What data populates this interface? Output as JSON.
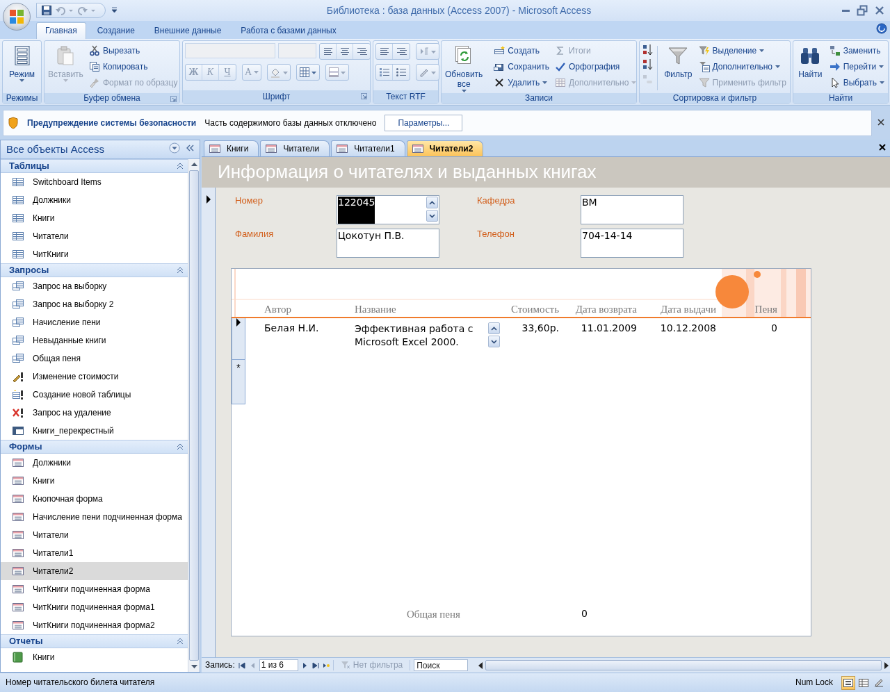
{
  "window": {
    "title": "Библиотека : база данных (Access 2007) - Microsoft Access"
  },
  "ribbon": {
    "tabs": [
      {
        "label": "Главная",
        "selected": true
      },
      {
        "label": "Создание",
        "selected": false
      },
      {
        "label": "Внешние данные",
        "selected": false
      },
      {
        "label": "Работа с базами данных",
        "selected": false
      }
    ],
    "groups": [
      {
        "kind": "views",
        "title": "Режимы",
        "launcher": false,
        "items": [
          {
            "label": "Режим",
            "kind": "large",
            "disabled": false,
            "dropdown": true
          }
        ]
      },
      {
        "kind": "clipboard",
        "title": "Буфер обмена",
        "launcher": true,
        "items": [
          {
            "label": "Вставить",
            "kind": "large",
            "disabled": true,
            "dropdown": true
          },
          {
            "label": "Вырезать",
            "kind": "small",
            "disabled": false,
            "dropdown": false
          },
          {
            "label": "Копировать",
            "kind": "small",
            "disabled": false,
            "dropdown": false
          },
          {
            "label": "Формат по образцу",
            "kind": "small",
            "disabled": true,
            "dropdown": false
          }
        ]
      },
      {
        "kind": "font",
        "title": "Шрифт",
        "launcher": true,
        "items": [
          {
            "label": "Ж",
            "kind": "bold",
            "disabled": true,
            "dropdown": false
          },
          {
            "label": "К",
            "kind": "italic",
            "disabled": true,
            "dropdown": false
          },
          {
            "label": "Ч",
            "kind": "underline",
            "disabled": true,
            "dropdown": false
          },
          {
            "label": "A",
            "kind": "font-color",
            "disabled": true,
            "dropdown": true
          }
        ]
      },
      {
        "kind": "rtf",
        "title": "Текст RTF",
        "launcher": false
      },
      {
        "kind": "records",
        "title": "Записи",
        "launcher": false,
        "items": [
          {
            "label": "Обновить все",
            "kind": "large",
            "disabled": false,
            "dropdown": true
          },
          {
            "label": "Создать",
            "kind": "small",
            "disabled": false,
            "dropdown": false
          },
          {
            "label": "Сохранить",
            "kind": "small",
            "disabled": false,
            "dropdown": false
          },
          {
            "label": "Удалить",
            "kind": "small",
            "disabled": false,
            "dropdown": true
          },
          {
            "label": "Итоги",
            "kind": "small",
            "disabled": true,
            "dropdown": false
          },
          {
            "label": "Орфография",
            "kind": "small",
            "disabled": false,
            "dropdown": false
          },
          {
            "label": "Дополнительно",
            "kind": "small",
            "disabled": true,
            "dropdown": true
          }
        ]
      },
      {
        "kind": "sort",
        "title": "Сортировка и фильтр",
        "launcher": false,
        "items": [
          {
            "label": "Фильтр",
            "kind": "large",
            "disabled": false,
            "dropdown": false
          },
          {
            "label": "Выделение",
            "kind": "small",
            "disabled": false,
            "dropdown": true
          },
          {
            "label": "Дополнительно",
            "kind": "small",
            "disabled": false,
            "dropdown": true
          },
          {
            "label": "Применить фильтр",
            "kind": "small",
            "disabled": true,
            "dropdown": false
          }
        ]
      },
      {
        "kind": "find",
        "title": "Найти",
        "launcher": false,
        "items": [
          {
            "label": "Найти",
            "kind": "large",
            "disabled": false,
            "dropdown": false
          },
          {
            "label": "Заменить",
            "kind": "small",
            "disabled": false,
            "dropdown": false
          },
          {
            "label": "Перейти",
            "kind": "small",
            "disabled": false,
            "dropdown": true
          },
          {
            "label": "Выбрать",
            "kind": "small",
            "disabled": false,
            "dropdown": true
          }
        ]
      }
    ]
  },
  "security_bar": {
    "title": "Предупреждение системы безопасности",
    "message": "Часть содержимого базы данных отключено",
    "button": "Параметры..."
  },
  "navigation": {
    "title": "Все объекты Access",
    "sections": [
      {
        "title": "Таблицы",
        "items": [
          {
            "label": "Switchboard Items",
            "kind": "table",
            "selected": false
          },
          {
            "label": "Должники",
            "kind": "table",
            "selected": false
          },
          {
            "label": "Книги",
            "kind": "table",
            "selected": false
          },
          {
            "label": "Читатели",
            "kind": "table",
            "selected": false
          },
          {
            "label": "ЧитКниги",
            "kind": "table",
            "selected": false
          }
        ]
      },
      {
        "title": "Запросы",
        "items": [
          {
            "label": "Запрос на выборку",
            "kind": "query",
            "selected": false
          },
          {
            "label": "Запрос на выборку 2",
            "kind": "query",
            "selected": false
          },
          {
            "label": "Начисление пени",
            "kind": "query",
            "selected": false
          },
          {
            "label": "Невыданные книги",
            "kind": "query",
            "selected": false
          },
          {
            "label": "Общая пеня",
            "kind": "query",
            "selected": false
          },
          {
            "label": "Изменение стоимости",
            "kind": "update",
            "selected": false
          },
          {
            "label": "Создание новой таблицы",
            "kind": "make-table",
            "selected": false
          },
          {
            "label": "Запрос на удаление",
            "kind": "delete",
            "selected": false
          },
          {
            "label": "Книги_перекрестный",
            "kind": "crosstab",
            "selected": false
          }
        ]
      },
      {
        "title": "Формы",
        "items": [
          {
            "label": "Должники",
            "kind": "form",
            "selected": false
          },
          {
            "label": "Книги",
            "kind": "form",
            "selected": false
          },
          {
            "label": "Кнопочная форма",
            "kind": "form",
            "selected": false
          },
          {
            "label": "Начисление пени подчиненная форма",
            "kind": "form",
            "selected": false
          },
          {
            "label": "Читатели",
            "kind": "form",
            "selected": false
          },
          {
            "label": "Читатели1",
            "kind": "form",
            "selected": false
          },
          {
            "label": "Читатели2",
            "kind": "form",
            "selected": true
          },
          {
            "label": "ЧитКниги подчиненная форма",
            "kind": "form",
            "selected": false
          },
          {
            "label": "ЧитКниги подчиненная форма1",
            "kind": "form",
            "selected": false
          },
          {
            "label": "ЧитКниги подчиненная форма2",
            "kind": "form",
            "selected": false
          }
        ]
      },
      {
        "title": "Отчеты",
        "items": [
          {
            "label": "Книги",
            "kind": "report",
            "selected": false
          }
        ]
      }
    ]
  },
  "document_tabs": [
    {
      "label": "Книги",
      "selected": false
    },
    {
      "label": "Читатели",
      "selected": false
    },
    {
      "label": "Читатели1",
      "selected": false
    },
    {
      "label": "Читатели2",
      "selected": true
    }
  ],
  "form": {
    "title": "Информация о читателях и выданных книгах",
    "fields": [
      {
        "label": "Номер",
        "value": "122045",
        "spinner": true,
        "text_selected": true
      },
      {
        "label": "Кафедра",
        "value": "ВМ",
        "spinner": false,
        "text_selected": false
      },
      {
        "label": "Фамилия",
        "value": "Цокотун П.В.",
        "spinner": false,
        "text_selected": false
      },
      {
        "label": "Телефон",
        "value": "704-14-14",
        "spinner": false,
        "text_selected": false
      }
    ],
    "subform": {
      "columns": [
        "Автор",
        "Название",
        "Стоимость",
        "Дата возврата",
        "Дата выдачи",
        "Пеня"
      ],
      "rows": [
        {
          "current": true,
          "cells": [
            "Белая Н.И.",
            "Эффективная работа с Microsoft Excel 2000.",
            "33,60р.",
            "11.01.2009",
            "10.12.2008",
            "0"
          ]
        }
      ],
      "new_row_marker": "*",
      "total": {
        "label": "Общая пеня",
        "value": "0"
      }
    }
  },
  "record_navigation": {
    "label": "Запись:",
    "position": "1 из 6",
    "filter": "Нет фильтра",
    "search_placeholder": "Поиск"
  },
  "status_bar": {
    "text": "Номер читательского билета читателя",
    "num_lock": "Num Lock",
    "view_buttons": [
      {
        "selected": true
      },
      {
        "selected": false
      },
      {
        "selected": false
      }
    ]
  }
}
